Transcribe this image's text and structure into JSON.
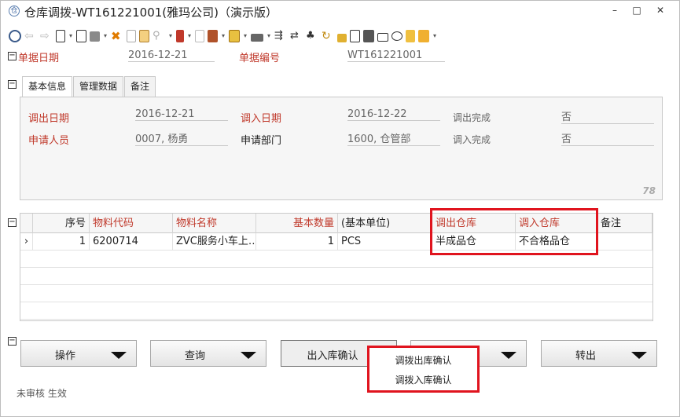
{
  "window": {
    "title": "仓库调拨-WT161221001(雅玛公司)（演示版）",
    "controls": [
      "–",
      "□",
      "✕"
    ]
  },
  "toolbar": {
    "icons": [
      "preview-icon",
      "back-icon",
      "forward-icon",
      "new-icon",
      "edit-icon",
      "save-icon",
      "delete-icon",
      "copy-icon",
      "paste-icon",
      "link-icon",
      "import-icon",
      "doc-icon",
      "export-icon",
      "image-icon",
      "print-icon",
      "filter-icon",
      "flow-icon",
      "tree-icon",
      "refresh-icon",
      "lock-icon",
      "calc-icon",
      "keyboard-icon",
      "mail-icon",
      "chat-icon",
      "note-icon",
      "tag-icon"
    ]
  },
  "header": {
    "date_label": "单据日期",
    "date_value": "2016-12-21",
    "number_label": "单据编号",
    "number_value": "WT161221001"
  },
  "tabs": [
    "基本信息",
    "管理数据",
    "备注"
  ],
  "basic": {
    "out_date_label": "调出日期",
    "out_date_value": "2016-12-21",
    "in_date_label": "调入日期",
    "in_date_value": "2016-12-22",
    "out_done_label": "调出完成",
    "out_done_value": "否",
    "applicant_label": "申请人员",
    "applicant_value": "0007, 杨勇",
    "dept_label": "申请部门",
    "dept_value": "1600, 仓管部",
    "in_done_label": "调入完成",
    "in_done_value": "否",
    "watermark": "78"
  },
  "grid": {
    "columns": [
      "序号",
      "物料代码",
      "物料名称",
      "基本数量",
      "(基本单位)",
      "调出仓库",
      "调入仓库",
      "备注"
    ],
    "rows": [
      {
        "marker": "›",
        "seq": "1",
        "code": "6200714",
        "name": "ZVC服务小车上…",
        "qty": "1",
        "unit": "PCS",
        "out_wh": "半成品仓",
        "in_wh": "不合格品仓",
        "note": ""
      }
    ]
  },
  "actions": {
    "operate": "操作",
    "query": "查询",
    "io_confirm": "出入库确认",
    "transfer_out": "转出"
  },
  "popup_menu": [
    "调拨出库确认",
    "调拨入库确认"
  ],
  "status": "未审核 生效"
}
